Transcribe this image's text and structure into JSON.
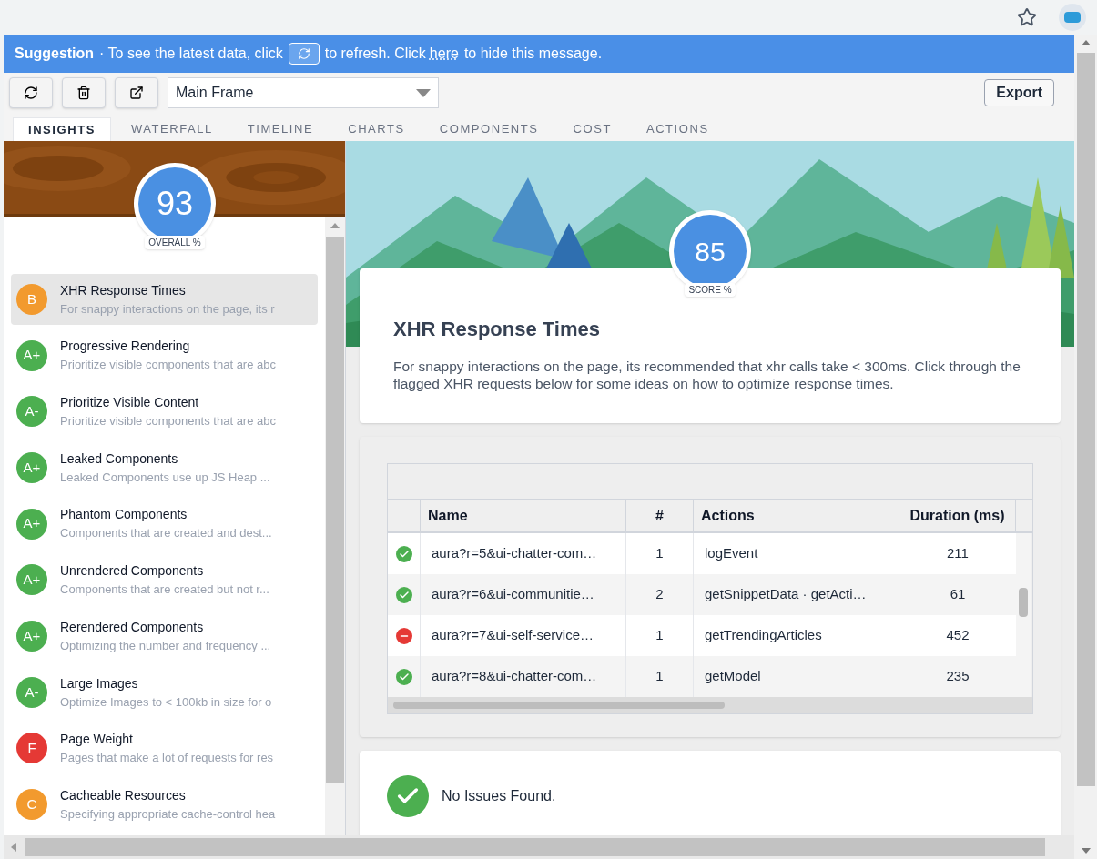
{
  "suggestion": {
    "label": "Suggestion",
    "text_before": "· To see the latest data, click",
    "text_after": "to refresh. Click",
    "link": "here",
    "text_end": "to hide this message."
  },
  "toolbar": {
    "frame_select": {
      "value": "Main Frame"
    },
    "export": "Export"
  },
  "tabs": [
    {
      "label": "INSIGHTS",
      "selected": true
    },
    {
      "label": "WATERFALL",
      "selected": false
    },
    {
      "label": "TIMELINE",
      "selected": false
    },
    {
      "label": "CHARTS",
      "selected": false
    },
    {
      "label": "COMPONENTS",
      "selected": false
    },
    {
      "label": "COST",
      "selected": false
    },
    {
      "label": "ACTIONS",
      "selected": false
    }
  ],
  "overall": {
    "score": "93",
    "label": "OVERALL %"
  },
  "insights": [
    {
      "grade": "B",
      "color": "#f29a2e",
      "title": "XHR Response Times",
      "description": "For snappy interactions on the page, its r",
      "selected": true
    },
    {
      "grade": "A+",
      "color": "#4caf50",
      "title": "Progressive Rendering",
      "description": "Prioritize visible components that are abc",
      "selected": false
    },
    {
      "grade": "A-",
      "color": "#4caf50",
      "title": "Prioritize Visible Content",
      "description": "Prioritize visible components that are abc",
      "selected": false
    },
    {
      "grade": "A+",
      "color": "#4caf50",
      "title": "Leaked Components",
      "description": "Leaked Components use up JS Heap ...",
      "selected": false
    },
    {
      "grade": "A+",
      "color": "#4caf50",
      "title": "Phantom Components",
      "description": "Components that are created and dest...",
      "selected": false
    },
    {
      "grade": "A+",
      "color": "#4caf50",
      "title": "Unrendered Components",
      "description": "Components that are created but not r...",
      "selected": false
    },
    {
      "grade": "A+",
      "color": "#4caf50",
      "title": "Rerendered Components",
      "description": "Optimizing the number and frequency ...",
      "selected": false
    },
    {
      "grade": "A-",
      "color": "#4caf50",
      "title": "Large Images",
      "description": "Optimize Images to < 100kb in size for o",
      "selected": false
    },
    {
      "grade": "F",
      "color": "#e53935",
      "title": "Page Weight",
      "description": "Pages that make a lot of requests for res",
      "selected": false
    },
    {
      "grade": "C",
      "color": "#f29a2e",
      "title": "Cacheable Resources",
      "description": "Specifying appropriate cache-control hea",
      "selected": false
    }
  ],
  "detail": {
    "score": "85",
    "score_label": "SCORE %",
    "title": "XHR Response Times",
    "description": "For snappy interactions on the page, its recommended that xhr calls take < 300ms. Click through the flagged XHR requests below for some ideas on how to optimize response times."
  },
  "table": {
    "columns": [
      "Name",
      "#",
      "Actions",
      "Duration (ms)"
    ],
    "rows": [
      {
        "passed": true,
        "name": "aura?r=5&ui-chatter-com…",
        "count": "1",
        "actions": "logEvent",
        "duration": "211"
      },
      {
        "passed": true,
        "name": "aura?r=6&ui-communitie…",
        "count": "2",
        "actions": "getSnippetData · getActi…",
        "duration": "61"
      },
      {
        "passed": false,
        "name": "aura?r=7&ui-self-service…",
        "count": "1",
        "actions": "getTrendingArticles",
        "duration": "452"
      },
      {
        "passed": true,
        "name": "aura?r=8&ui-chatter-com…",
        "count": "1",
        "actions": "getModel",
        "duration": "235"
      }
    ]
  },
  "result": {
    "passed": true,
    "text": "No Issues Found."
  }
}
